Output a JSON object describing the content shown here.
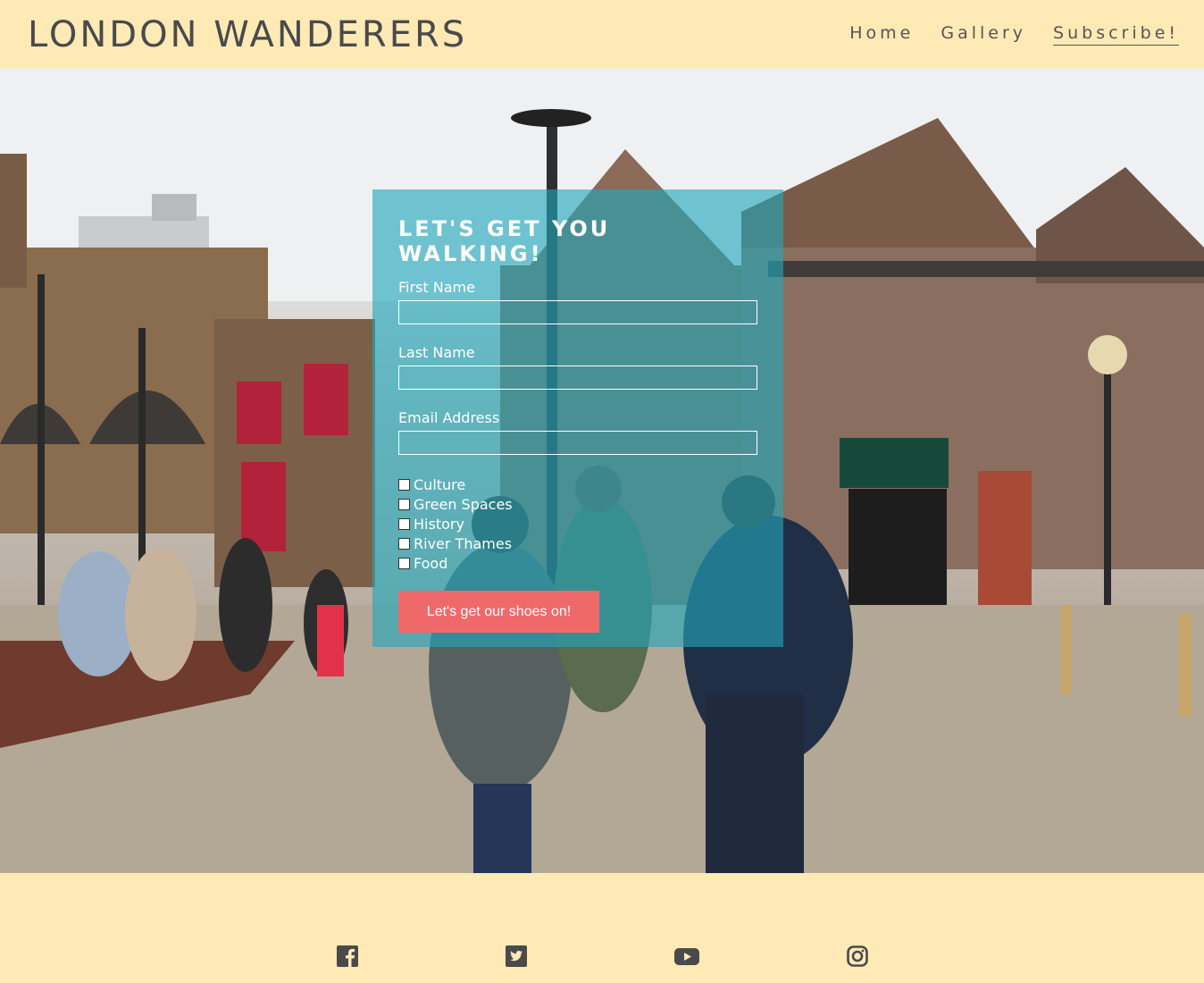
{
  "header": {
    "brand": "LONDON WANDERERS",
    "nav": [
      {
        "label": "Home"
      },
      {
        "label": "Gallery"
      },
      {
        "label": "Subscribe!"
      }
    ]
  },
  "form": {
    "title": "Let's get you walking!",
    "fields": [
      {
        "label": "First Name",
        "value": ""
      },
      {
        "label": "Last Name",
        "value": ""
      },
      {
        "label": "Email Address",
        "value": ""
      }
    ],
    "interests": [
      {
        "label": "Culture",
        "checked": false
      },
      {
        "label": "Green Spaces",
        "checked": false
      },
      {
        "label": "History",
        "checked": false
      },
      {
        "label": "River Thames",
        "checked": false
      },
      {
        "label": "Food",
        "checked": false
      }
    ],
    "submit_label": "Let's get our shoes on!"
  },
  "colors": {
    "header_bg": "#ffeab6",
    "panel_bg": "#20a8bc",
    "button_bg": "#f0696a",
    "icon": "#4a4a4a"
  },
  "footer": {
    "social": [
      {
        "icon": "facebook-icon"
      },
      {
        "icon": "twitter-icon"
      },
      {
        "icon": "youtube-icon"
      },
      {
        "icon": "instagram-icon"
      }
    ]
  }
}
